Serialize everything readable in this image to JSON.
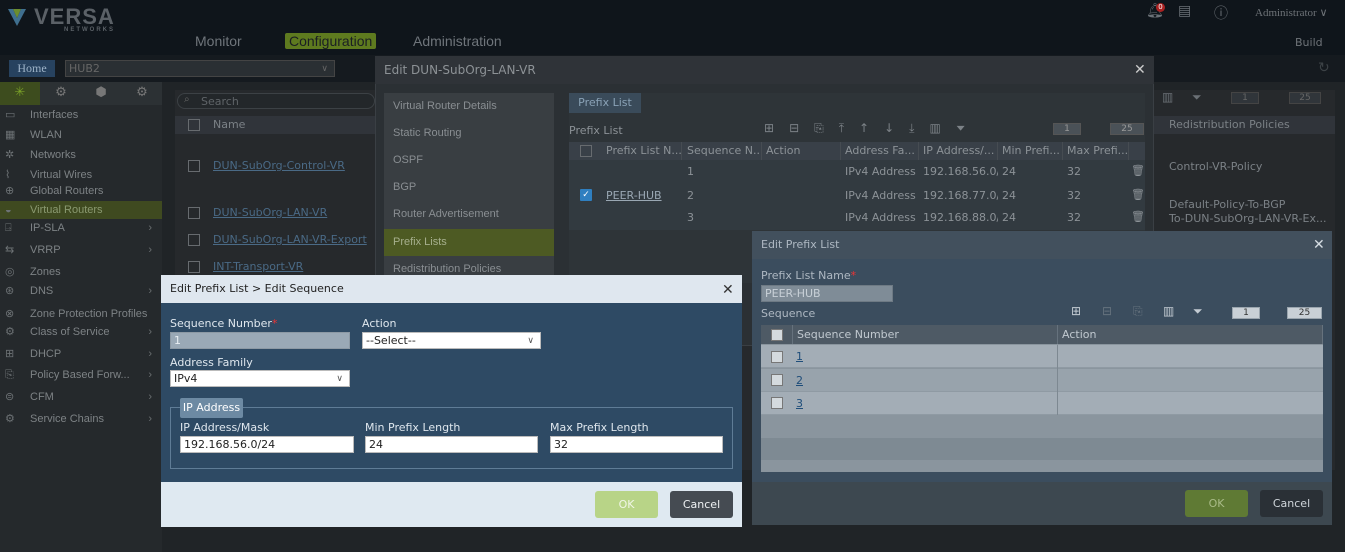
{
  "header": {
    "logo": "VERSA",
    "logo_sub": "NETWORKS",
    "nav": [
      "Monitor",
      "Configuration",
      "Administration"
    ],
    "user": "Administrator",
    "build": "Build",
    "notif_count": "0"
  },
  "subbar": {
    "home": "Home",
    "appliance": "HUB2"
  },
  "left_nav": {
    "items": [
      {
        "label": "Interfaces",
        "icon": "interfaces-icon",
        "has_children": false
      },
      {
        "label": "WLAN",
        "icon": "wifi-icon",
        "has_children": false
      },
      {
        "label": "Networks",
        "icon": "networks-icon",
        "has_children": false
      },
      {
        "label": "Virtual Wires",
        "icon": "virtual-wires-icon",
        "has_children": false
      },
      {
        "label": "Global Routers",
        "icon": "global-routers-icon",
        "has_children": false
      },
      {
        "label": "Virtual Routers",
        "icon": "virtual-routers-icon",
        "has_children": false,
        "active": true
      },
      {
        "label": "IP-SLA",
        "icon": "ip-sla-icon",
        "has_children": true
      },
      {
        "label": "VRRP",
        "icon": "vrrp-icon",
        "has_children": true
      },
      {
        "label": "Zones",
        "icon": "zones-icon",
        "has_children": false
      },
      {
        "label": "DNS",
        "icon": "dns-icon",
        "has_children": true
      },
      {
        "label": "Zone Protection Profiles",
        "icon": "zone-protection-icon",
        "has_children": false
      },
      {
        "label": "Class of Service",
        "icon": "cos-icon",
        "has_children": true
      },
      {
        "label": "DHCP",
        "icon": "dhcp-icon",
        "has_children": true
      },
      {
        "label": "Policy Based Forw...",
        "icon": "pbf-icon",
        "has_children": true
      },
      {
        "label": "CFM",
        "icon": "cfm-icon",
        "has_children": true
      },
      {
        "label": "Service Chains",
        "icon": "service-chains-icon",
        "has_children": true
      }
    ]
  },
  "main_grid": {
    "search_placeholder": "Search",
    "col_name": "Name",
    "col_redistribution": "Redistribution Policies",
    "rows": [
      {
        "name": "DUN-SubOrg-Control-VR",
        "redistribution": "Control-VR-Policy"
      },
      {
        "name": "DUN-SubOrg-LAN-VR",
        "redistribution": "Default-Policy-To-BGP"
      },
      {
        "name": "DUN-SubOrg-LAN-VR-Export",
        "redistribution": "To-DUN-SubOrg-LAN-VR-Ex..."
      },
      {
        "name": "INT-Transport-VR",
        "redistribution": ""
      }
    ],
    "page": "1",
    "page_size": "25"
  },
  "edit_vr": {
    "title": "Edit DUN-SubOrg-LAN-VR",
    "side_items": [
      "Virtual Router Details",
      "Static Routing",
      "OSPF",
      "BGP",
      "Router Advertisement",
      "Prefix Lists",
      "Redistribution Policies"
    ],
    "tab": "Prefix List",
    "section_label": "Prefix List",
    "page": "1",
    "page_size": "25",
    "columns": [
      "Prefix List N...",
      "Sequence N...",
      "Action",
      "Address Fa...",
      "IP Address/...",
      "Min Prefi...",
      "Max Prefi..."
    ],
    "prefix_list_name": "PEER-HUB",
    "rows": [
      {
        "seq": "1",
        "action": "",
        "family": "IPv4 Address",
        "ip": "192.168.56.0/24",
        "min": "24",
        "max": "32"
      },
      {
        "seq": "2",
        "action": "",
        "family": "IPv4 Address",
        "ip": "192.168.77.0/24",
        "min": "24",
        "max": "32"
      },
      {
        "seq": "3",
        "action": "",
        "family": "IPv4 Address",
        "ip": "192.168.88.0/24",
        "min": "24",
        "max": "32"
      }
    ]
  },
  "edit_seq": {
    "title": "Edit Prefix List > Edit Sequence",
    "seq_label": "Sequence Number",
    "seq_value": "1",
    "action_label": "Action",
    "action_value": "--Select--",
    "family_label": "Address Family",
    "family_value": "IPv4",
    "ip_legend": "IP Address",
    "ip_label": "IP Address/Mask",
    "ip_value": "192.168.56.0/24",
    "min_label": "Min Prefix Length",
    "min_value": "24",
    "max_label": "Max Prefix Length",
    "max_value": "32",
    "ok": "OK",
    "cancel": "Cancel"
  },
  "edit_pl": {
    "title": "Edit Prefix List",
    "name_label": "Prefix List Name",
    "name_value": "PEER-HUB",
    "seq_section": "Sequence",
    "col_seq": "Sequence Number",
    "col_action": "Action",
    "page": "1",
    "page_size": "25",
    "rows": [
      {
        "seq": "1",
        "action": ""
      },
      {
        "seq": "2",
        "action": ""
      },
      {
        "seq": "3",
        "action": ""
      }
    ],
    "ok": "OK",
    "cancel": "Cancel"
  },
  "colors": {
    "accent_green": "#5e7a1f",
    "dialog_blue": "#2e4a64",
    "ok_green": "#b8d487"
  }
}
